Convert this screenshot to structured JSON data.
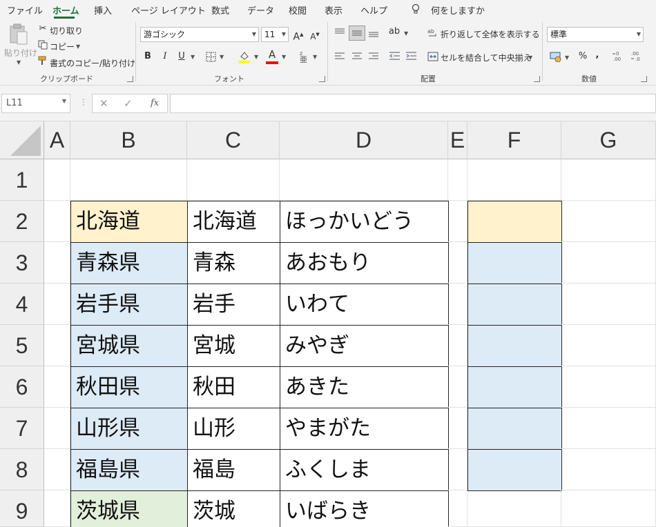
{
  "menu": {
    "tabs": [
      "ファイル",
      "ホーム",
      "挿入",
      "ページ レイアウト",
      "数式",
      "データ",
      "校閲",
      "表示",
      "ヘルプ"
    ],
    "active_tab": "ホーム",
    "tell_me": "何をしますか"
  },
  "ribbon": {
    "clipboard": {
      "paste_label": "貼り付け",
      "cut_label": "切り取り",
      "copy_label": "コピー",
      "format_painter_label": "書式のコピー/貼り付け",
      "group_label": "クリップボード"
    },
    "font": {
      "font_name": "游ゴシック",
      "font_size": "11",
      "bold": "B",
      "italic": "I",
      "underline": "U",
      "font_color_glyph": "A",
      "group_label": "フォント"
    },
    "alignment": {
      "wrap_text_label": "折り返して全体を表示する",
      "merge_center_label": "セルを結合して中央揃え",
      "group_label": "配置"
    },
    "number": {
      "format": "標準",
      "percent": "%",
      "comma": ",",
      "group_label": "数値"
    }
  },
  "formula_bar": {
    "name_box": "L11",
    "fx": "fx",
    "formula": ""
  },
  "sheet": {
    "columns": [
      "A",
      "B",
      "C",
      "D",
      "E",
      "F",
      "G"
    ],
    "rows": [
      "1",
      "2",
      "3",
      "4",
      "5",
      "6",
      "7",
      "8",
      "9"
    ],
    "cells": {
      "B2": "北海道",
      "C2": "北海道",
      "D2": "ほっかいどう",
      "B3": "青森県",
      "C3": "青森",
      "D3": "あおもり",
      "B4": "岩手県",
      "C4": "岩手",
      "D4": "いわて",
      "B5": "宮城県",
      "C5": "宮城",
      "D5": "みやぎ",
      "B6": "秋田県",
      "C6": "秋田",
      "D6": "あきた",
      "B7": "山形県",
      "C7": "山形",
      "D7": "やまがた",
      "B8": "福島県",
      "C8": "福島",
      "D8": "ふくしま",
      "B9": "茨城県",
      "C9": "茨城",
      "D9": "いばらき"
    },
    "fill_colors": {
      "orange": "#fff2cc",
      "blue": "#ddebf7",
      "green": "#e2efda"
    }
  }
}
